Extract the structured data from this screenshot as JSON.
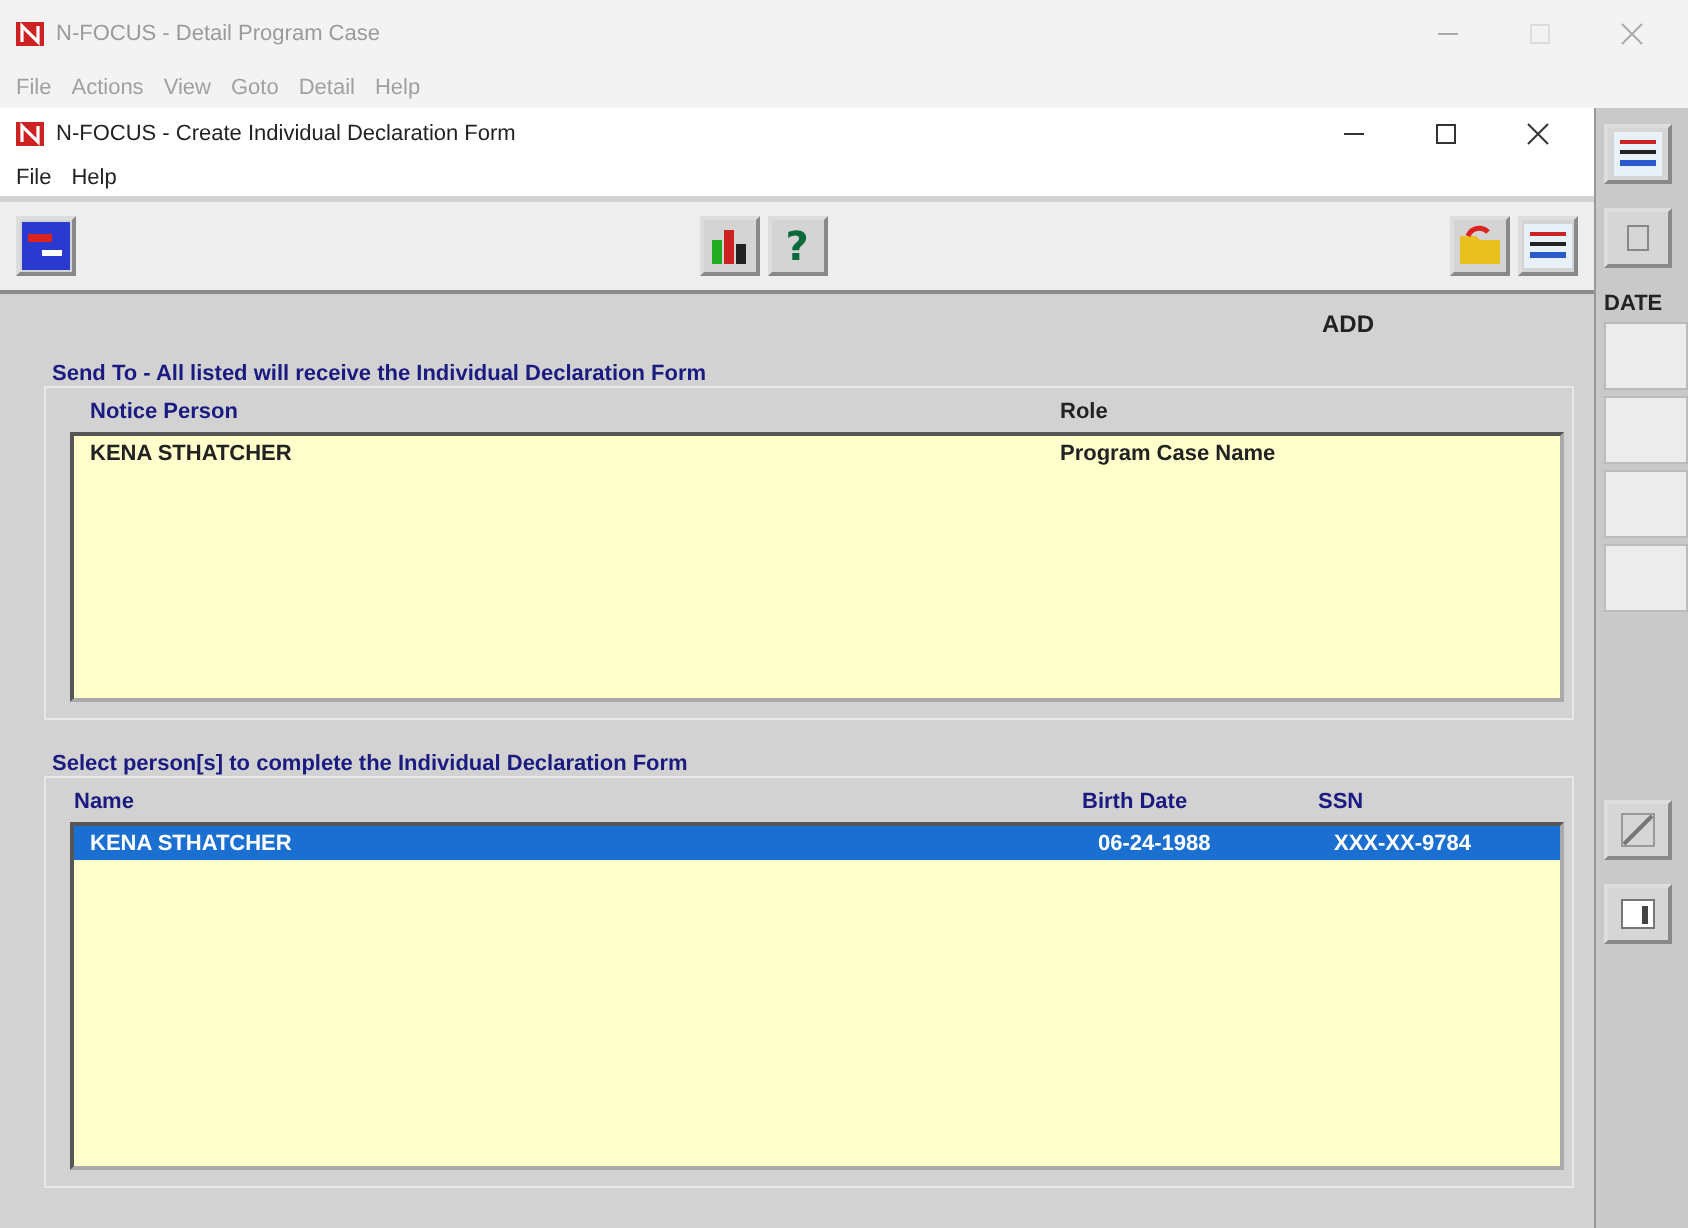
{
  "background_window": {
    "title": "N-FOCUS - Detail Program Case",
    "menu": [
      "File",
      "Actions",
      "View",
      "Goto",
      "Detail",
      "Help"
    ],
    "side_label": "DATE"
  },
  "window": {
    "title": "N-FOCUS - Create Individual Declaration Form",
    "menu": [
      "File",
      "Help"
    ],
    "help_label": "?",
    "mode": "ADD",
    "send_to": {
      "title": "Send To - All listed will receive the Individual Declaration Form",
      "columns": [
        "Notice Person",
        "Role"
      ],
      "rows": [
        {
          "cells": [
            "KENA STHATCHER",
            "Program Case Name"
          ],
          "selected": false
        }
      ]
    },
    "persons": {
      "title": "Select person[s] to complete the Individual Declaration Form",
      "columns": [
        "Name",
        "Birth Date",
        "SSN"
      ],
      "rows": [
        {
          "cells": [
            "KENA STHATCHER",
            "06-24-1988",
            "XXX-XX-9784"
          ],
          "selected": true
        }
      ]
    }
  }
}
